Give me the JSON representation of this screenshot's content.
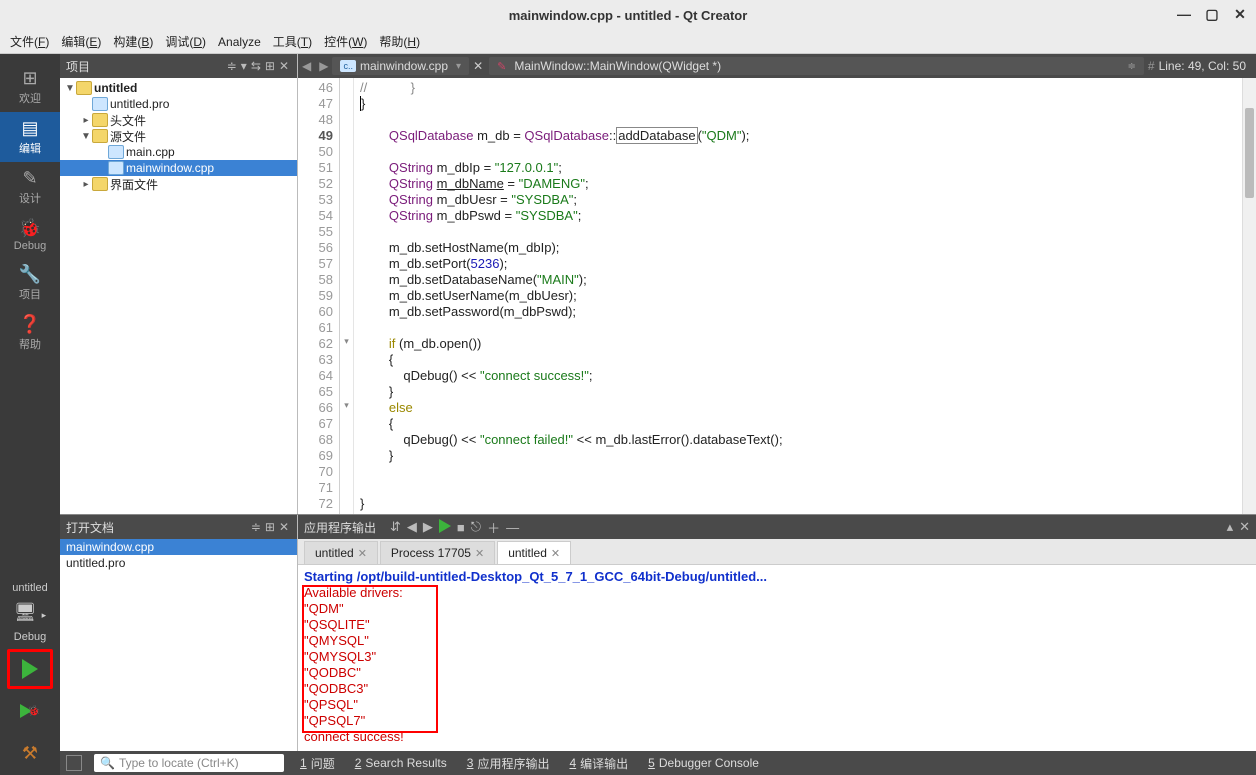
{
  "window": {
    "title": "mainwindow.cpp - untitled - Qt Creator"
  },
  "menu": [
    "文件(F)",
    "编辑(E)",
    "构建(B)",
    "调试(D)",
    "Analyze",
    "工具(T)",
    "控件(W)",
    "帮助(H)"
  ],
  "sidebar": {
    "items": [
      {
        "label": "欢迎",
        "icon": "⊞"
      },
      {
        "label": "编辑",
        "icon": "▤"
      },
      {
        "label": "设计",
        "icon": "✎"
      },
      {
        "label": "Debug",
        "icon": "🐞"
      },
      {
        "label": "项目",
        "icon": "🔧"
      },
      {
        "label": "帮助",
        "icon": "❓"
      }
    ],
    "target": "untitled",
    "mode": "Debug"
  },
  "project_header": "项目",
  "tree": [
    {
      "depth": 0,
      "exp": "▼",
      "icon": "folder",
      "label": "untitled",
      "bold": true
    },
    {
      "depth": 1,
      "exp": "",
      "icon": "cpp",
      "label": "untitled.pro"
    },
    {
      "depth": 1,
      "exp": "▸",
      "icon": "folder",
      "label": "头文件"
    },
    {
      "depth": 1,
      "exp": "▼",
      "icon": "folder",
      "label": "源文件"
    },
    {
      "depth": 2,
      "exp": "",
      "icon": "cpp",
      "label": "main.cpp"
    },
    {
      "depth": 2,
      "exp": "",
      "icon": "cpp",
      "label": "mainwindow.cpp",
      "sel": true
    },
    {
      "depth": 1,
      "exp": "▸",
      "icon": "folder",
      "label": "界面文件"
    }
  ],
  "editor": {
    "file": "mainwindow.cpp",
    "crumb": "MainWindow::MainWindow(QWidget *)",
    "linecol": "Line: 49, Col: 50",
    "lines": [
      {
        "n": 46,
        "html": "<span class='c-com'>//            }</span>"
      },
      {
        "n": 47,
        "html": "<span style='border-left:1px solid #000;'></span>}"
      },
      {
        "n": 48,
        "html": ""
      },
      {
        "n": 49,
        "cur": true,
        "html": "        <span class='c-type'>QSqlDatabase</span> m_db = <span class='c-type'>QSqlDatabase</span>::<span class='c-box'>addDatabase</span>(<span class='c-str'>\"QDM\"</span>);"
      },
      {
        "n": 50,
        "html": ""
      },
      {
        "n": 51,
        "html": "        <span class='c-type'>QString</span> m_dbIp = <span class='c-str'>\"127.0.0.1\"</span>;"
      },
      {
        "n": 52,
        "html": "        <span class='c-type'>QString</span> <u>m_dbName</u> = <span class='c-str'>\"DAMENG\"</span>;"
      },
      {
        "n": 53,
        "html": "        <span class='c-type'>QString</span> m_dbUesr = <span class='c-str'>\"SYSDBA\"</span>;"
      },
      {
        "n": 54,
        "html": "        <span class='c-type'>QString</span> m_dbPswd = <span class='c-str'>\"SYSDBA\"</span>;"
      },
      {
        "n": 55,
        "html": ""
      },
      {
        "n": 56,
        "html": "        m_db.setHostName(m_dbIp);"
      },
      {
        "n": 57,
        "html": "        m_db.setPort(<span class='c-num'>5236</span>);"
      },
      {
        "n": 58,
        "html": "        m_db.setDatabaseName(<span class='c-str'>\"MAIN\"</span>);"
      },
      {
        "n": 59,
        "html": "        m_db.setUserName(m_dbUesr);"
      },
      {
        "n": 60,
        "html": "        m_db.setPassword(m_dbPswd);"
      },
      {
        "n": 61,
        "html": ""
      },
      {
        "n": 62,
        "fold": "▾",
        "html": "        <span class='c-kw'>if</span> (m_db.open())"
      },
      {
        "n": 63,
        "html": "        {"
      },
      {
        "n": 64,
        "html": "            qDebug() &lt;&lt; <span class='c-str'>\"connect success!\"</span>;"
      },
      {
        "n": 65,
        "html": "        }"
      },
      {
        "n": 66,
        "fold": "▾",
        "html": "        <span class='c-kw'>else</span>"
      },
      {
        "n": 67,
        "html": "        {"
      },
      {
        "n": 68,
        "html": "            qDebug() &lt;&lt; <span class='c-str'>\"connect failed!\"</span> &lt;&lt; m_db.lastError().databaseText();"
      },
      {
        "n": 69,
        "html": "        }"
      },
      {
        "n": 70,
        "html": ""
      },
      {
        "n": 71,
        "html": ""
      },
      {
        "n": 72,
        "html": "}"
      }
    ]
  },
  "openfiles": {
    "header": "打开文档",
    "items": [
      {
        "name": "mainwindow.cpp",
        "sel": true
      },
      {
        "name": "untitled.pro"
      }
    ]
  },
  "output": {
    "header": "应用程序输出",
    "tabs": [
      {
        "name": "untitled"
      },
      {
        "name": "Process 17705"
      },
      {
        "name": "untitled",
        "active": true
      }
    ],
    "start": "Starting /opt/build-untitled-Desktop_Qt_5_7_1_GCC_64bit-Debug/untitled...",
    "red": [
      "Available drivers:",
      "\"QDM\"",
      "\"QSQLITE\"",
      "\"QMYSQL\"",
      "\"QMYSQL3\"",
      "\"QODBC\"",
      "\"QODBC3\"",
      "\"QPSQL\"",
      "\"QPSQL7\"",
      "connect success!"
    ]
  },
  "status": {
    "placeholder": "Type to locate (Ctrl+K)",
    "tabs": [
      {
        "n": "1",
        "t": "问题"
      },
      {
        "n": "2",
        "t": "Search Results"
      },
      {
        "n": "3",
        "t": "应用程序输出"
      },
      {
        "n": "4",
        "t": "编译输出"
      },
      {
        "n": "5",
        "t": "Debugger Console"
      }
    ]
  }
}
